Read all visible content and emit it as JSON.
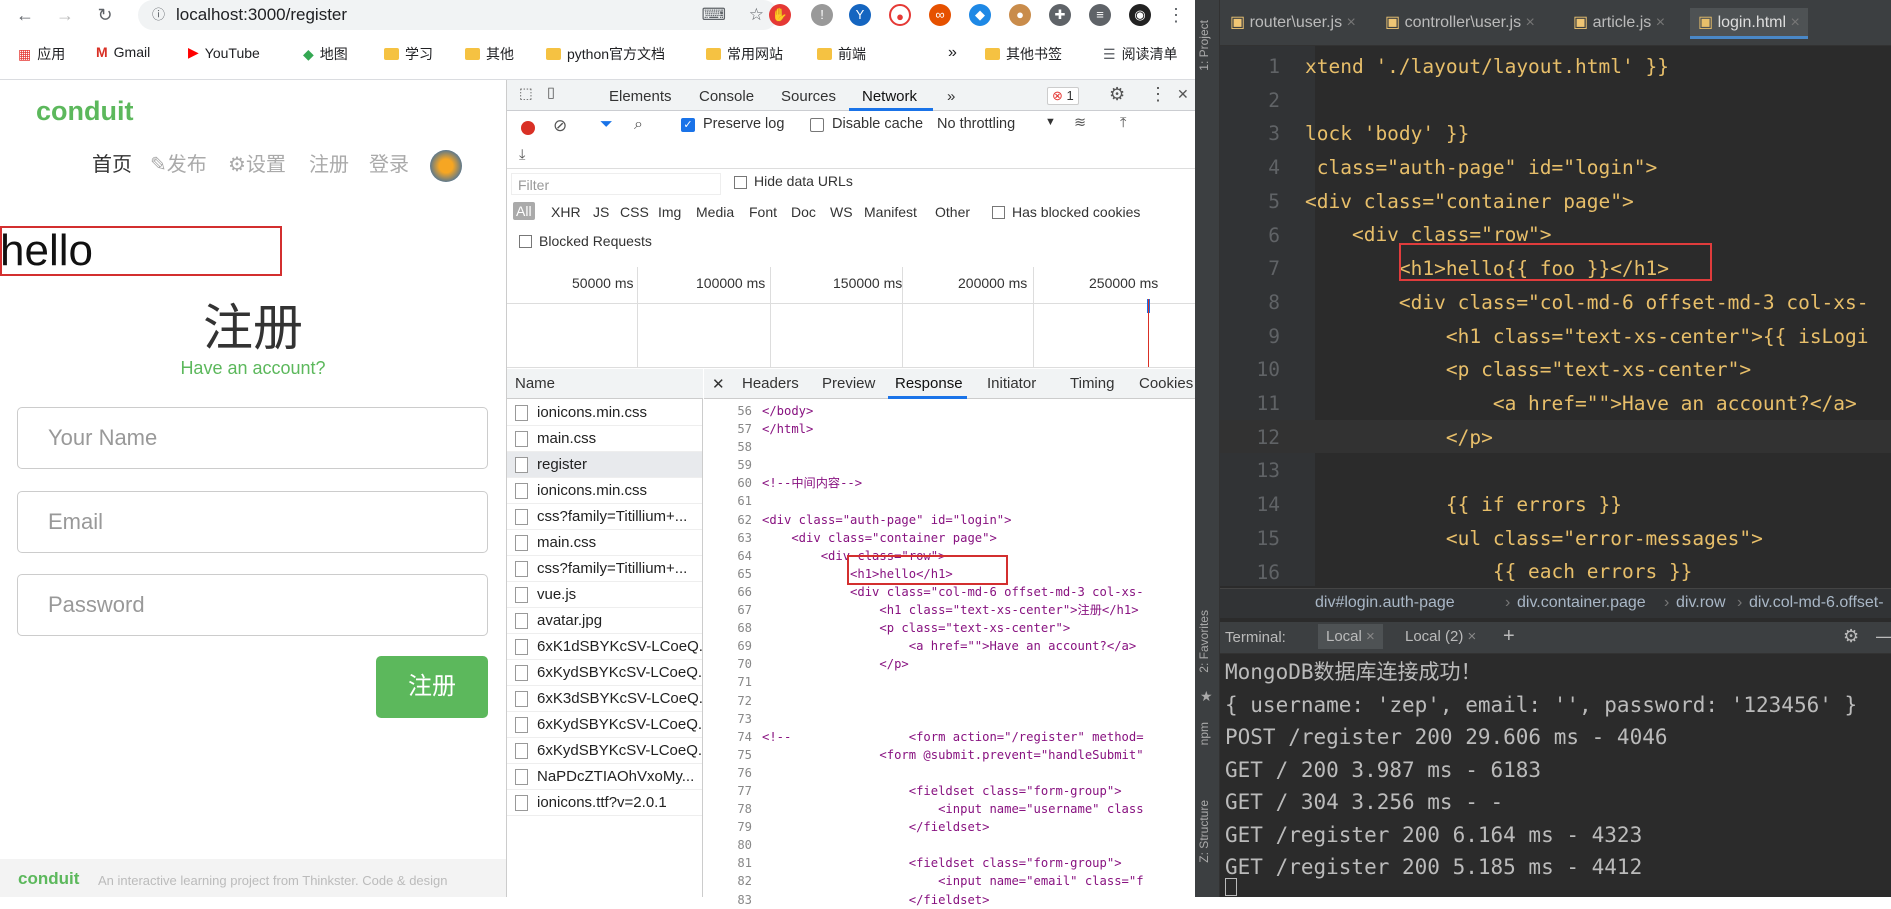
{
  "browser": {
    "url": "localhost:3000/register",
    "bookmarks": [
      "应用",
      "Gmail",
      "YouTube",
      "地图",
      "学习",
      "其他",
      "python官方文档",
      "常用网站",
      "前端",
      "»",
      "其他书签",
      "阅读清单"
    ]
  },
  "page": {
    "brand": "conduit",
    "nav": [
      "首页",
      "发布",
      "设置",
      "注册",
      "登录"
    ],
    "hello": "hello",
    "title": "注册",
    "have_account": "Have an account?",
    "placeholders": {
      "name": "Your Name",
      "email": "Email",
      "password": "Password"
    },
    "submit": "注册",
    "footer_brand": "conduit",
    "footer_text": "An interactive learning project from Thinkster. Code & design"
  },
  "devtools": {
    "tabs": [
      "Elements",
      "Console",
      "Sources",
      "Network",
      "»"
    ],
    "active_tab": "Network",
    "error_count": "1",
    "preserve_log": "Preserve log",
    "disable_cache": "Disable cache",
    "throttle": "No throttling",
    "filter_placeholder": "Filter",
    "hide_data_urls": "Hide data URLs",
    "types": [
      "All",
      "XHR",
      "JS",
      "CSS",
      "Img",
      "Media",
      "Font",
      "Doc",
      "WS",
      "Manifest",
      "Other"
    ],
    "has_blocked": "Has blocked cookies",
    "blocked_requests": "Blocked Requests",
    "timeline": [
      "50000 ms",
      "100000 ms",
      "150000 ms",
      "200000 ms",
      "250000 ms"
    ],
    "name_header": "Name",
    "files": [
      "ionicons.min.css",
      "main.css",
      "register",
      "ionicons.min.css",
      "css?family=Titillium+...",
      "main.css",
      "css?family=Titillium+...",
      "vue.js",
      "avatar.jpg",
      "6xK1dSBYKcSV-LCoeQ...",
      "6xKydSBYKcSV-LCoeQ...",
      "6xK3dSBYKcSV-LCoeQ...",
      "6xKydSBYKcSV-LCoeQ...",
      "6xKydSBYKcSV-LCoeQ...",
      "NaPDcZTIAOhVxoMy...",
      "ionicons.ttf?v=2.0.1"
    ],
    "detail_tabs": [
      "Headers",
      "Preview",
      "Response",
      "Initiator",
      "Timing",
      "Cookies"
    ],
    "active_detail": "Response",
    "line_numbers": "56\n57\n58\n59\n60\n61\n62\n63\n64\n65\n66\n67\n68\n69\n70\n71\n72\n73\n74\n75\n76\n77\n78\n79\n80\n81\n82\n83",
    "response_code": "</body>\n</html>\n\n\n<!--中间内容-->\n\n<div class=\"auth-page\" id=\"login\">\n    <div class=\"container page\">\n        <div class=\"row\">\n            <h1>hello</h1>\n            <div class=\"col-md-6 offset-md-3 col-xs-\n                <h1 class=\"text-xs-center\">注册</h1>\n                <p class=\"text-xs-center\">\n                    <a href=\"\">Have an account?</a>\n                </p>\n\n\n\n<!--                <form action=\"/register\" method=\n                <form @submit.prevent=\"handleSubmit\"\n\n                    <fieldset class=\"form-group\">\n                        <input name=\"username\" class\n                    </fieldset>\n\n                    <fieldset class=\"form-group\">\n                        <input name=\"email\" class=\"f\n                    </fieldset>"
  },
  "ide": {
    "tabs": [
      "router\\user.js",
      "controller\\user.js",
      "article.js",
      "login.html"
    ],
    "active_tab": "login.html",
    "side_labels": [
      "1: Project",
      "2: Favorites",
      "npm",
      "Z: Structure"
    ],
    "line_numbers": "1\n2\n3\n4\n5\n6\n7\n8\n9\n10\n11\n12\n13\n14\n15\n16",
    "code_lines": [
      "xtend './layout/layout.html' }}",
      "",
      "lock 'body' }}",
      " class=\"auth-page\" id=\"login\">",
      "<div class=\"container page\">",
      "    <div class=\"row\">",
      "        <h1>hello{{ foo }}</h1>",
      "        <div class=\"col-md-6 offset-md-3 col-xs-",
      "            <h1 class=\"text-xs-center\">{{ isLogi",
      "            <p class=\"text-xs-center\">",
      "                <a href=\"\">Have an account?</a>",
      "            </p>",
      "",
      "            {{ if errors }}",
      "            <ul class=\"error-messages\">",
      "                {{ each errors }}"
    ],
    "breadcrumb": [
      "div#login.auth-page",
      "div.container.page",
      "div.row",
      "div.col-md-6.offset-"
    ],
    "terminal_label": "Terminal:",
    "terminal_tabs": [
      "Local",
      "Local (2)"
    ],
    "terminal_lines": [
      "MongoDB数据库连接成功！",
      "{ username: 'zep', email: '', password: '123456' }",
      "POST /register 200 29.606 ms - 4046",
      "GET / 200 3.987 ms - 6183",
      "GET / 304 3.256 ms - -",
      "GET /register 200 6.164 ms - 4323",
      "GET /register 200 5.185 ms - 4412"
    ]
  },
  "colors": {
    "brand": "#5cb85c",
    "highlight_box": "#e03c3c",
    "ide_bg": "#2b2b2b"
  }
}
